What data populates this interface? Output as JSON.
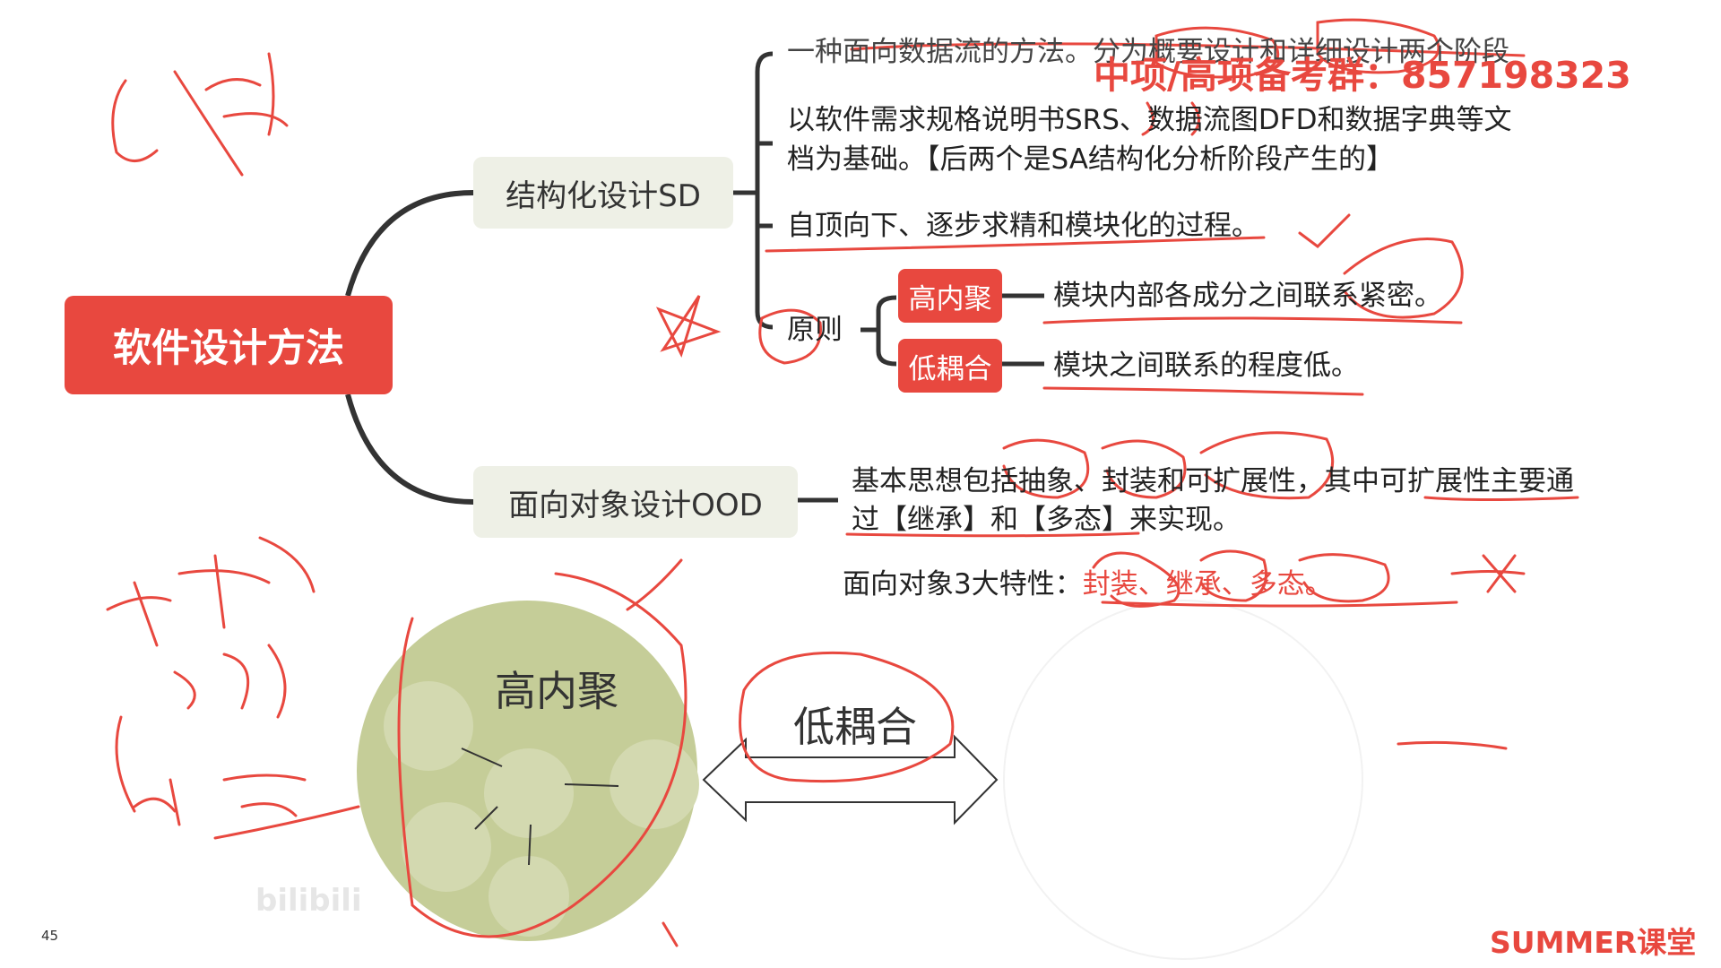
{
  "root": {
    "label": "软件设计方法"
  },
  "sd": {
    "label": "结构化设计SD",
    "items": [
      "一种面向数据流的方法。分为概要设计和详细设计两个阶段",
      "以软件需求规格说明书SRS、数据流图DFD和数据字典等文",
      "档为基础。【后两个是SA结构化分析阶段产生的】",
      "自顶向下、逐步求精和模块化的过程。"
    ],
    "principle_label": "原则",
    "principles": [
      {
        "tag": "高内聚",
        "desc": "模块内部各成分之间联系紧密。"
      },
      {
        "tag": "低耦合",
        "desc": "模块之间联系的程度低。"
      }
    ]
  },
  "ood": {
    "label": "面向对象设计OOD",
    "line1": "基本思想包括抽象、封装和可扩展性，其中可扩展性主要通",
    "line2": "过【继承】和【多态】来实现。",
    "features_prefix": "面向对象3大特性：",
    "features": "封装、继承、多态。"
  },
  "diagram": {
    "cohesion_label": "高内聚",
    "coupling_label": "低耦合"
  },
  "watermark": "中项/高项备考群：857198323",
  "page_number": "45",
  "brand": {
    "prefix": "SUMMER",
    "suffix": "课堂"
  },
  "bilibili": "bilibili",
  "colors": {
    "accent": "#e8483f",
    "branch_bg": "#eef0e6",
    "circle": "#c5cd98"
  }
}
